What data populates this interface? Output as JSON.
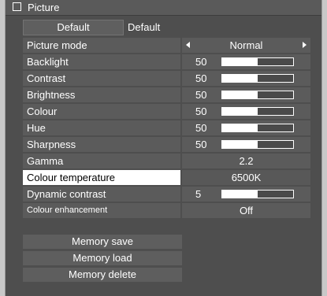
{
  "window": {
    "title": "Picture"
  },
  "default": {
    "button_label": "Default",
    "value": "Default"
  },
  "rows": [
    {
      "label": "Picture mode",
      "type": "select",
      "value": "Normal"
    },
    {
      "label": "Backlight",
      "type": "slider",
      "value": "50",
      "level": 0.5
    },
    {
      "label": "Contrast",
      "type": "slider",
      "value": "50",
      "level": 0.5
    },
    {
      "label": "Brightness",
      "type": "slider",
      "value": "50",
      "level": 0.5
    },
    {
      "label": "Colour",
      "type": "slider",
      "value": "50",
      "level": 0.5
    },
    {
      "label": "Hue",
      "type": "slider",
      "value": "50",
      "level": 0.5
    },
    {
      "label": "Sharpness",
      "type": "slider",
      "value": "50",
      "level": 0.5
    },
    {
      "label": "Gamma",
      "type": "text",
      "value": "2.2"
    },
    {
      "label": "Colour temperature",
      "type": "text",
      "value": "6500K",
      "selected": true
    },
    {
      "label": "Dynamic contrast",
      "type": "slider",
      "value": "5",
      "level": 0.5
    },
    {
      "label": "Colour enhancement",
      "type": "text",
      "value": "Off",
      "small": true
    }
  ],
  "memory": {
    "save": "Memory save",
    "load": "Memory load",
    "delete": "Memory delete"
  },
  "colors": {
    "panel": "#4e4e4e",
    "row": "#5b5b5b",
    "selected": "#ffffff",
    "outer": "#c8c8c8"
  },
  "icons": {
    "title_checkbox": "checkbox-icon",
    "select_left": "arrow-left-icon",
    "select_right": "arrow-right-icon"
  }
}
